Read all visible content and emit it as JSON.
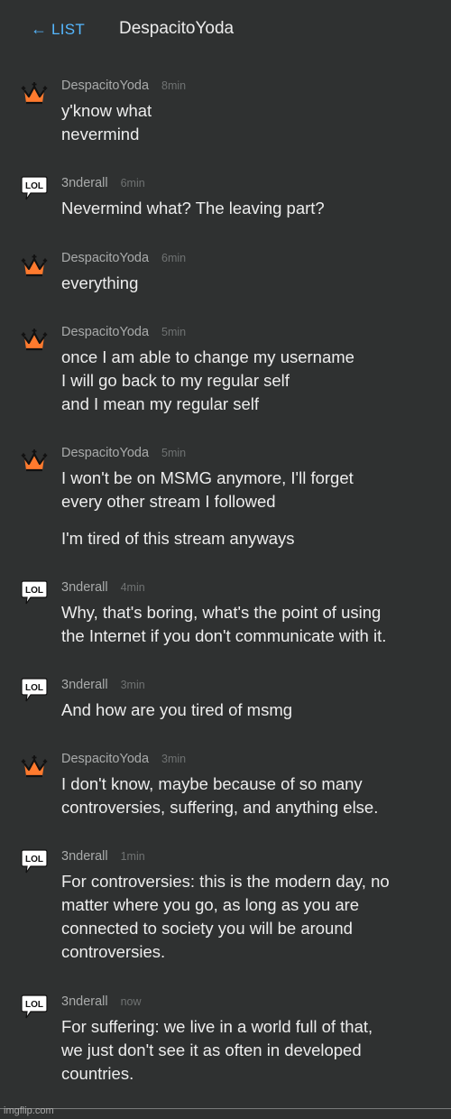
{
  "header": {
    "back_arrow": "←",
    "back_label": "LIST",
    "title": "DespacitoYoda"
  },
  "colors": {
    "background": "#2f3131",
    "accent_link": "#55b7ff",
    "crown_orange": "#ff7a2e"
  },
  "messages": [
    {
      "user": "DespacitoYoda",
      "time": "8min",
      "avatar": "crown-icon",
      "lines": [
        "y'know what",
        "nevermind"
      ]
    },
    {
      "user": "3nderall",
      "time": "6min",
      "avatar": "lol-bubble-icon",
      "lines": [
        "Nevermind what? The leaving part?"
      ]
    },
    {
      "user": "DespacitoYoda",
      "time": "6min",
      "avatar": "crown-icon",
      "lines": [
        "everything"
      ]
    },
    {
      "user": "DespacitoYoda",
      "time": "5min",
      "avatar": "crown-icon",
      "lines": [
        "once I am able to change my username",
        "I will go back to my regular self",
        "and I mean my regular self"
      ]
    },
    {
      "user": "DespacitoYoda",
      "time": "5min",
      "avatar": "crown-icon",
      "lines": [
        "I won't be on MSMG anymore, I'll forget",
        "every other stream I followed",
        "I'm tired of this stream anyways"
      ]
    },
    {
      "user": "3nderall",
      "time": "4min",
      "avatar": "lol-bubble-icon",
      "lines": [
        "Why, that's boring, what's the point of using",
        "the Internet if you don't communicate with it."
      ]
    },
    {
      "user": "3nderall",
      "time": "3min",
      "avatar": "lol-bubble-icon",
      "lines": [
        "And how are you tired of msmg"
      ]
    },
    {
      "user": "DespacitoYoda",
      "time": "3min",
      "avatar": "crown-icon",
      "lines": [
        "I don't know, maybe because of so many",
        "controversies, suffering, and anything else."
      ]
    },
    {
      "user": "3nderall",
      "time": "1min",
      "avatar": "lol-bubble-icon",
      "lines": [
        "For controversies: this is the modern day, no",
        "matter where you go, as long as you are",
        "connected to society you will be around",
        "controversies."
      ]
    },
    {
      "user": "3nderall",
      "time": "now",
      "avatar": "lol-bubble-icon",
      "lines": [
        "For suffering: we live in a world full of that,",
        "we just don't see it as often in developed",
        "countries."
      ]
    }
  ],
  "avatar_text": {
    "lol": "LOL"
  },
  "watermark": "imgflip.com"
}
